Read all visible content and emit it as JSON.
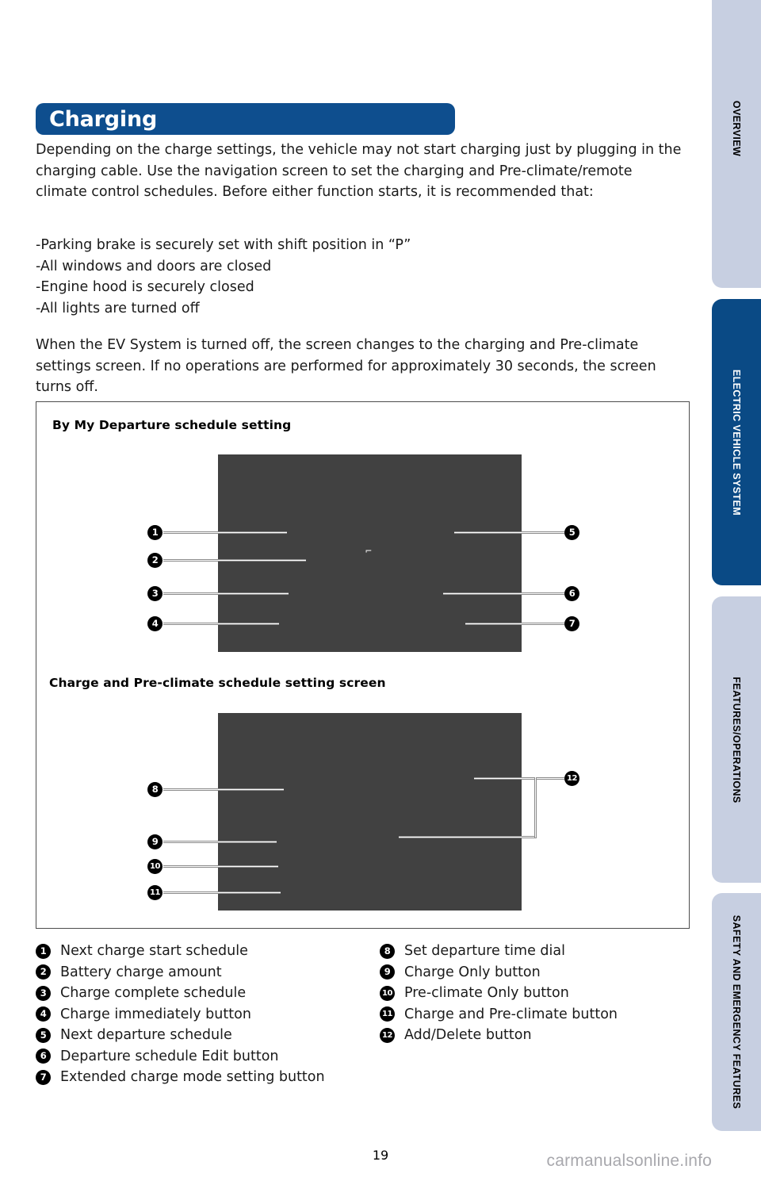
{
  "section": {
    "title": "Charging"
  },
  "paragraphs": {
    "intro": "Depending on the charge settings, the vehicle may not start charging just by plugging in the charging cable. Use the navigation screen to set the charging and Pre-climate/remote climate control schedules. Before either function starts, it is recommended that:",
    "conditions": "-Parking brake is securely set with shift position in “P”\n-All windows and doors are closed\n-Engine hood is securely closed\n-All lights are turned off",
    "ev_off": "When the EV System is turned off, the screen changes to the charging and Pre-climate settings screen. If no operations are performed for approximately 30 seconds, the screen turns off."
  },
  "figure": {
    "caption_1": "By My Departure schedule setting",
    "caption_2": "Charge and Pre-climate schedule setting screen",
    "screen_glyph": "⌐"
  },
  "callouts": {
    "c1": "1",
    "c2": "2",
    "c3": "3",
    "c4": "4",
    "c5": "5",
    "c6": "6",
    "c7": "7",
    "c8": "8",
    "c9": "9",
    "c10": "10",
    "c11": "11",
    "c12": "12"
  },
  "legend": {
    "left": [
      {
        "num": "1",
        "label": "Next charge start schedule"
      },
      {
        "num": "2",
        "label": "Battery charge amount"
      },
      {
        "num": "3",
        "label": "Charge complete schedule"
      },
      {
        "num": "4",
        "label": "Charge immediately button"
      },
      {
        "num": "5",
        "label": "Next departure schedule"
      },
      {
        "num": "6",
        "label": "Departure schedule Edit button"
      },
      {
        "num": "7",
        "label": "Extended charge mode setting button"
      }
    ],
    "right": [
      {
        "num": "8",
        "label": "Set departure time dial"
      },
      {
        "num": "9",
        "label": "Charge Only button"
      },
      {
        "num": "10",
        "label": "Pre-climate Only button"
      },
      {
        "num": "11",
        "label": "Charge and Pre-climate button"
      },
      {
        "num": "12",
        "label": "Add/Delete button"
      }
    ]
  },
  "side_tabs": [
    {
      "label": "OVERVIEW",
      "style": "light"
    },
    {
      "label": "ELECTRIC VEHICLE SYSTEM",
      "style": "dark"
    },
    {
      "label": "FEATURES/OPERATIONS",
      "style": "light"
    },
    {
      "label": "SAFETY AND EMERGENCY FEATURES",
      "style": "light"
    }
  ],
  "footer": {
    "page_number": "19",
    "watermark": "carmanualsonline.info"
  },
  "colors": {
    "header_blue": "#0e4e8e",
    "tab_dark_blue": "#0a4a85",
    "tab_light_blue": "#c7cfe1",
    "screenshot_grey": "#414141",
    "watermark_grey": "#a8a8ad"
  }
}
